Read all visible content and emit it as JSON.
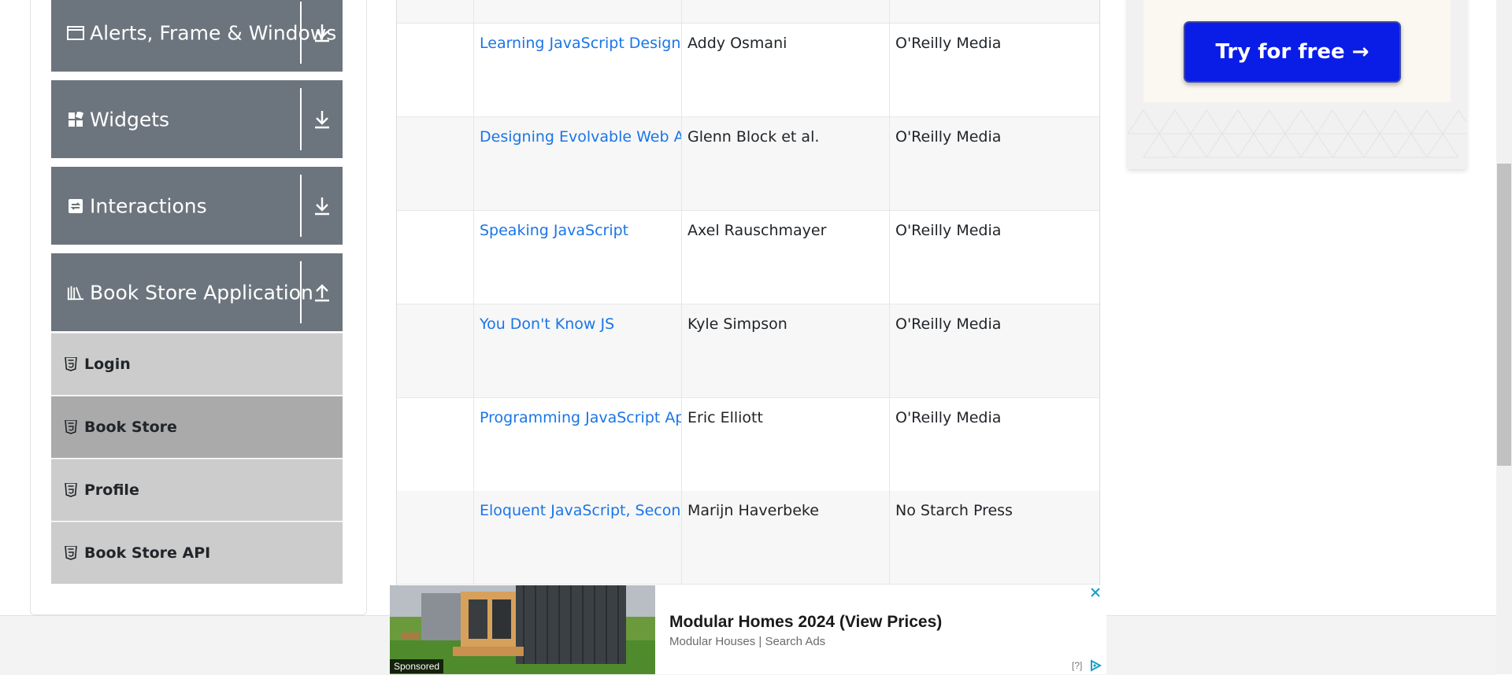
{
  "sidebar": {
    "groups": [
      {
        "label": "Alerts, Frame & Windows",
        "icon": "window-icon",
        "arrow": "download-arrow-icon"
      },
      {
        "label": "Widgets",
        "icon": "widgets-icon",
        "arrow": "download-arrow-icon"
      },
      {
        "label": "Interactions",
        "icon": "interactions-icon",
        "arrow": "download-arrow-icon"
      },
      {
        "label": "Book Store Application",
        "icon": "books-icon",
        "arrow": "upload-arrow-icon"
      }
    ],
    "items": [
      {
        "label": "Login",
        "icon": "html5-icon"
      },
      {
        "label": "Book Store",
        "icon": "html5-icon",
        "active": true
      },
      {
        "label": "Profile",
        "icon": "html5-icon"
      },
      {
        "label": "Book Store API",
        "icon": "html5-icon"
      }
    ]
  },
  "books": {
    "rows": [
      {
        "title": "Learning JavaScript Design Pa",
        "author": "Addy Osmani",
        "publisher": "O'Reilly Media"
      },
      {
        "title": "Designing Evolvable Web API",
        "author": "Glenn Block et al.",
        "publisher": "O'Reilly Media"
      },
      {
        "title": "Speaking JavaScript",
        "author": "Axel Rauschmayer",
        "publisher": "O'Reilly Media"
      },
      {
        "title": "You Don't Know JS",
        "author": "Kyle Simpson",
        "publisher": "O'Reilly Media"
      },
      {
        "title": "Programming JavaScript App",
        "author": "Eric Elliott",
        "publisher": "O'Reilly Media"
      },
      {
        "title": "Eloquent JavaScript, Second E",
        "author": "Marijn Haverbeke",
        "publisher": "No Starch Press"
      }
    ]
  },
  "top_ad": {
    "button_label": "Try for free →",
    "button_color": "#0a1de6"
  },
  "bottom_ad": {
    "title": "Modular Homes 2024 (View Prices)",
    "source": "Modular Houses | Search Ads",
    "sponsored": "Sponsored",
    "help": "[?]"
  },
  "colors": {
    "group_header_bg": "#6c757d",
    "menu_item_bg": "#cccccc",
    "menu_item_active_bg": "#aaaaaa",
    "link": "#1a75e8"
  }
}
